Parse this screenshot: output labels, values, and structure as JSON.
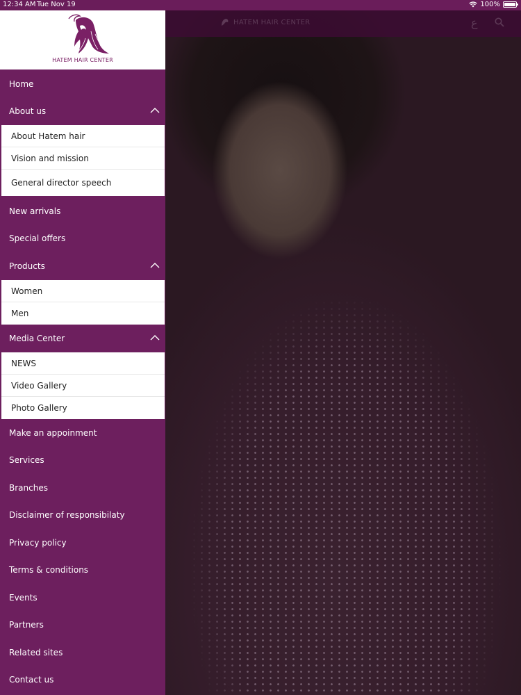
{
  "status_bar": {
    "time": "12:34 AM",
    "date": "Tue Nov 19",
    "battery": "100%",
    "wifi_icon": "wifi-icon",
    "battery_icon": "battery-icon"
  },
  "header": {
    "brand": "HATEM HAIR CENTER",
    "lang_toggle": "ع",
    "search_icon": "search-icon"
  },
  "logo": {
    "text": "HATEM HAIR CENTER"
  },
  "menu": {
    "home": "Home",
    "about": "About us",
    "about_sub": [
      "About Hatem hair",
      "Vision and mission",
      "General director speech"
    ],
    "new_arrivals": "New arrivals",
    "special_offers": "Special offers",
    "products": "Products",
    "products_sub": [
      "Women",
      "Men"
    ],
    "media_center": "Media Center",
    "media_sub": [
      "NEWS",
      "Video Gallery",
      "Photo Gallery"
    ],
    "appointment": "Make an appoinment",
    "services": "Services",
    "branches": "Branches",
    "disclaimer": "Disclaimer of responsibilaty",
    "privacy": "Privacy policy",
    "terms": "Terms & conditions",
    "events": "Events",
    "partners": "Partners",
    "related": "Related sites",
    "contact": "Contact us"
  },
  "colors": {
    "drawer": "#6d1f5e",
    "status_bar": "#6a1d5a",
    "submenu_bg": "#ffffff"
  }
}
